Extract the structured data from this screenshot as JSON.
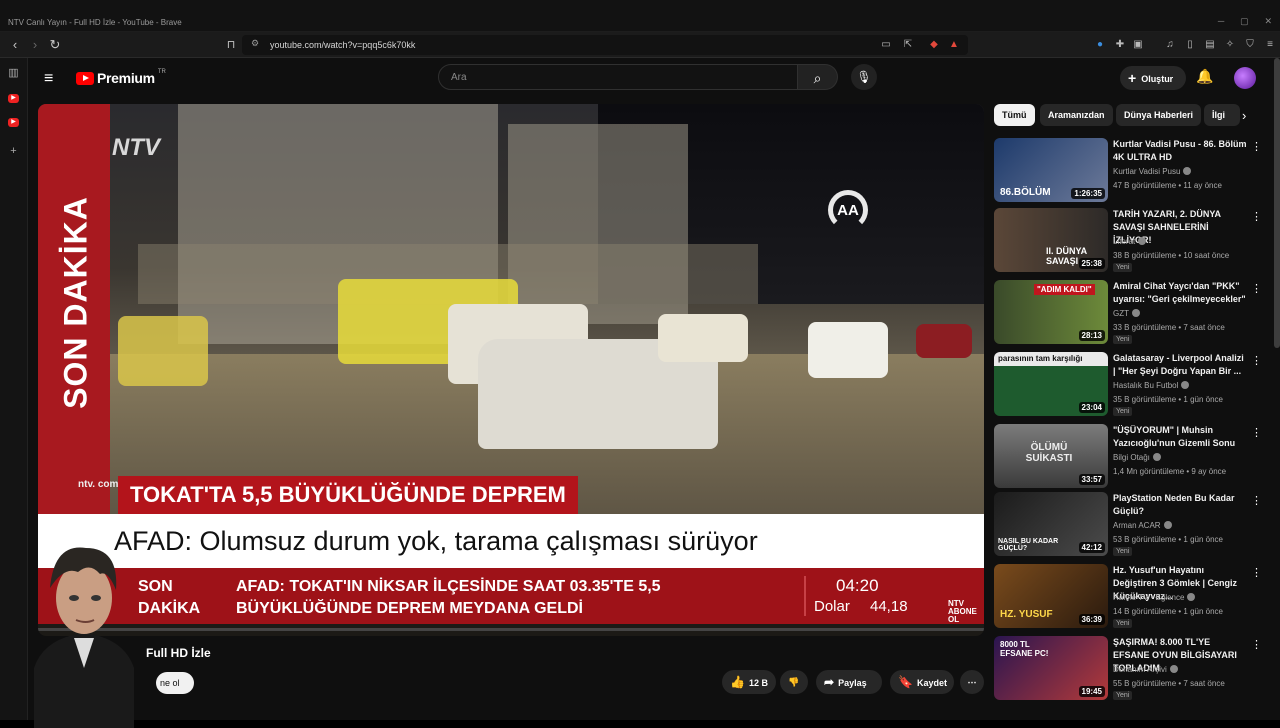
{
  "window": {
    "title": "NTV Canlı Yayın - Full HD İzle - YouTube - Brave"
  },
  "browser": {
    "url": "youtube.com/watch?v=pqq5c6k70kk"
  },
  "youtube": {
    "logo": "Premium",
    "logo_suffix": "TR",
    "search_placeholder": "Ara",
    "create_label": "Oluştur"
  },
  "video": {
    "side_banner": "SON DAKİKA",
    "channel_watermark": "NTV",
    "agency_logo": "AA",
    "site_tag": "ntv. com. tr",
    "headline": "TOKAT'TA 5,5 BÜYÜKLÜĞÜNDE DEPREM",
    "subline": "AFAD: Olumsuz durum yok, tarama çalışması sürüyor",
    "ticker_label": "SON DAKİKA",
    "ticker_text": "AFAD: TOKAT'IN NİKSAR İLÇESİNDE SAAT 03.35'TE 5,5 BÜYÜKLÜĞÜNDE DEPREM MEYDANA GELDİ",
    "time": "04:20",
    "dolar_label": "Dolar",
    "dolar_value": "44,18",
    "ntv_small": "NTV ABONE OL",
    "title_visible": "Full HD İzle",
    "subscribe_partial": "ne ol",
    "likes": "12 B",
    "share": "Paylaş",
    "save": "Kaydet"
  },
  "chips": [
    "Tümü",
    "Aramanızdan",
    "Dünya Haberleri",
    "İlgi"
  ],
  "recommendations": [
    {
      "title": "Kurtlar Vadisi Pusu - 86. Bölüm 4K ULTRA HD",
      "channel": "Kurtlar Vadisi Pusu",
      "meta": "47 B görüntüleme • 11 ay önce",
      "duration": "1:26:35",
      "thumb_text": "86.BÖLÜM",
      "new": ""
    },
    {
      "title": "TARİH YAZARI, 2. DÜNYA SAVAŞI SAHNELERİNİ İZLİYOR!",
      "channel": "Literat",
      "meta": "38 B görüntüleme • 10 saat önce",
      "duration": "25:38",
      "thumb_text": "II. DÜNYA SAVAŞI",
      "new": "Yeni"
    },
    {
      "title": "Amiral Cihat Yaycı'dan \"PKK\" uyarısı: \"Geri çekilmeyecekler\"",
      "channel": "GZT",
      "meta": "33 B görüntüleme • 7 saat önce",
      "duration": "28:13",
      "thumb_text": "\"ADIM KALDI\"",
      "new": "Yeni"
    },
    {
      "title": "Galatasaray - Liverpool Analizi | \"Her Şeyi Doğru Yapan Bir ...",
      "channel": "Hastalık Bu Futbol",
      "meta": "35 B görüntüleme • 1 gün önce",
      "duration": "23:04",
      "thumb_text": "parasının tam karşılığı",
      "new": "Yeni"
    },
    {
      "title": "\"ÜŞÜYORUM\" | Muhsin Yazıcıoğlu'nun Gizemli Sonu",
      "channel": "Bilgi Otağı",
      "meta": "1,4 Mn görüntüleme • 9 ay önce",
      "duration": "33:57",
      "thumb_text": "ÖLÜMÜ SUİKASTI",
      "new": ""
    },
    {
      "title": "PlayStation Neden Bu Kadar Güçlü?",
      "channel": "Arman ACAR",
      "meta": "53 B görüntüleme • 1 gün önce",
      "duration": "42:12",
      "thumb_text": "NASIL BU KADAR GÜÇLÜ?",
      "new": "Yeni"
    },
    {
      "title": "Hz. Yusuf'un Hayatını Değiştiren 3 Gömlek | Cengiz Küçükayvaz...",
      "channel": "Rafine TV - Eğlence",
      "meta": "14 B görüntüleme • 1 gün önce",
      "duration": "36:39",
      "thumb_text": "HZ. YUSUF",
      "new": "Yeni"
    },
    {
      "title": "ŞAŞIRMA! 8.000 TL'YE EFSANE OYUN BİLGİSAYARI TOPLADIM",
      "channel": "Donanım Arşivi",
      "meta": "55 B görüntüleme • 7 saat önce",
      "duration": "19:45",
      "thumb_text": "8000 TL EFSANE PC!",
      "new": "Yeni"
    }
  ],
  "colors": {
    "accent": "#ff0000",
    "ntv_red": "#b3141b",
    "bg": "#0f0f0f"
  }
}
